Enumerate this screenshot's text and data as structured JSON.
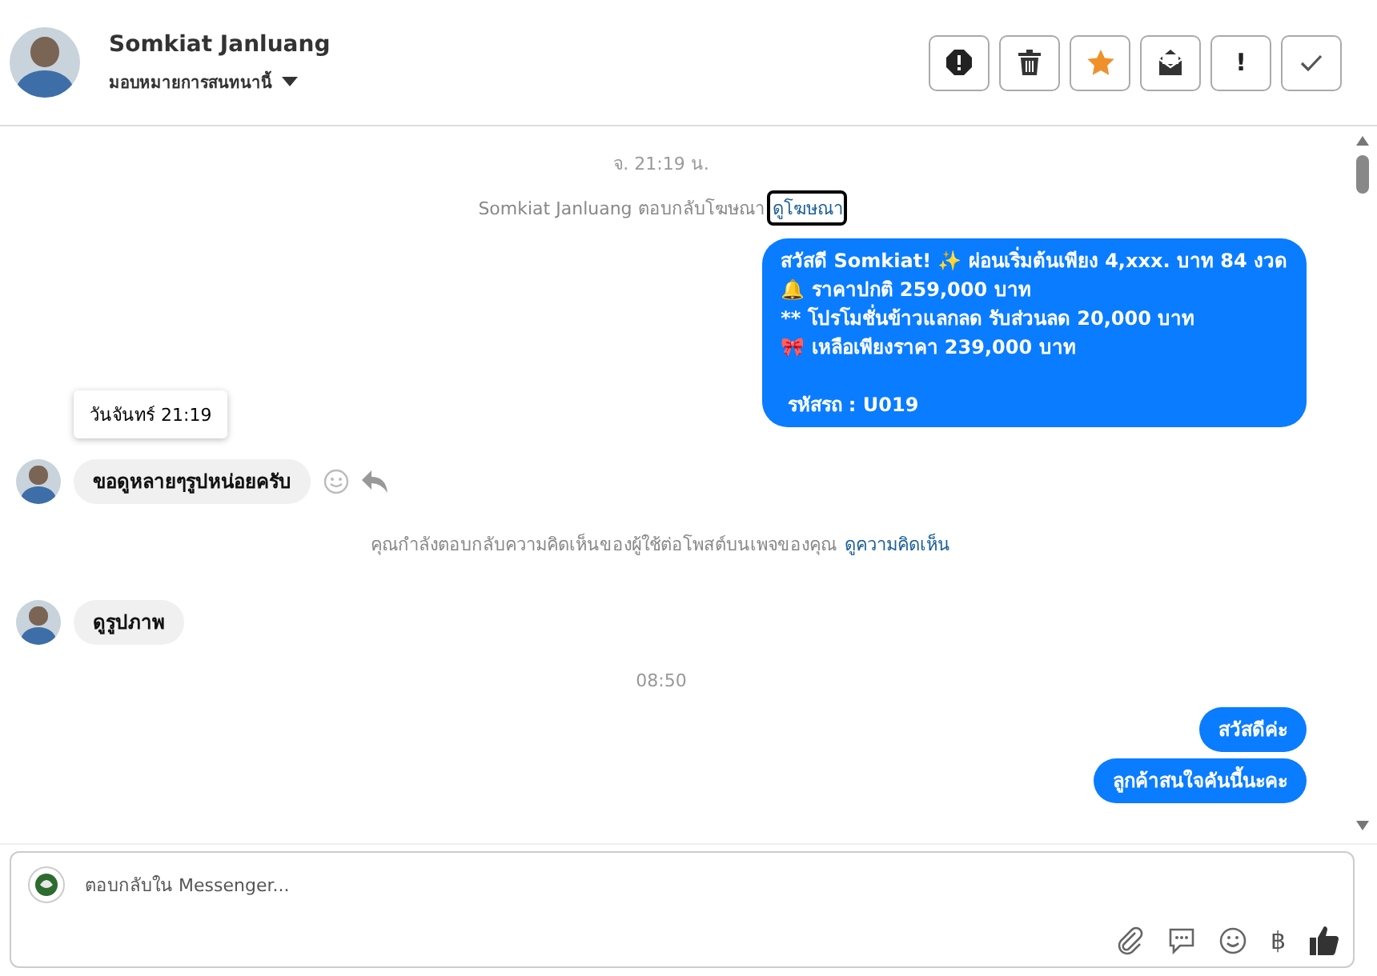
{
  "header": {
    "name": "Somkiat Janluang",
    "assign": "มอบหมายการสนทนานี้",
    "buttons": [
      {
        "kind": "alert"
      },
      {
        "kind": "trash"
      },
      {
        "kind": "star"
      },
      {
        "kind": "mail"
      },
      {
        "kind": "text",
        "label": "!"
      },
      {
        "kind": "check"
      }
    ]
  },
  "messages": [
    {
      "kind": "time",
      "text": "จ. 21:19 น."
    },
    {
      "kind": "notice",
      "text": "Somkiat Janluang ตอบกลับโฆษณา",
      "link": "ดูโฆษณา",
      "focused": true
    },
    {
      "kind": "outgoing",
      "lines": [
        "สวัสดี Somkiat! ✨ ผ่อนเริ่มต้นเพียง 4,xxx. บาท 84 งวด",
        "🔔 ราคาปกติ 259,000 บาท",
        "** โปรโมชั่นข้าวแลกลด รับส่วนลด 20,000 บาท",
        "🎀 เหลือเพียงราคา 239,000 บาท"
      ],
      "footer": " รหัสรถ : U019"
    },
    {
      "kind": "incoming",
      "text": "ขอดูหลายๆรูปหน่อยครับ",
      "tooltip": "วันจันทร์ 21:19",
      "actions": true
    },
    {
      "kind": "notice",
      "text": "คุณกำลังตอบกลับความคิดเห็นของผู้ใช้ต่อโพสต์บนเพจของคุณ",
      "link": "ดูความคิดเห็น",
      "focused": false
    },
    {
      "kind": "incoming",
      "text": "ดูรูปภาพ",
      "actions": false
    },
    {
      "kind": "time",
      "text": "08:50"
    },
    {
      "kind": "outgoing",
      "lines": [
        "สวัสดีค่ะ"
      ]
    },
    {
      "kind": "outgoing",
      "lines": [
        "ลูกค้าสนใจคันนี้นะคะ"
      ]
    }
  ],
  "composer": {
    "placeholder": "ตอบกลับใน Messenger...",
    "currency": "฿"
  }
}
